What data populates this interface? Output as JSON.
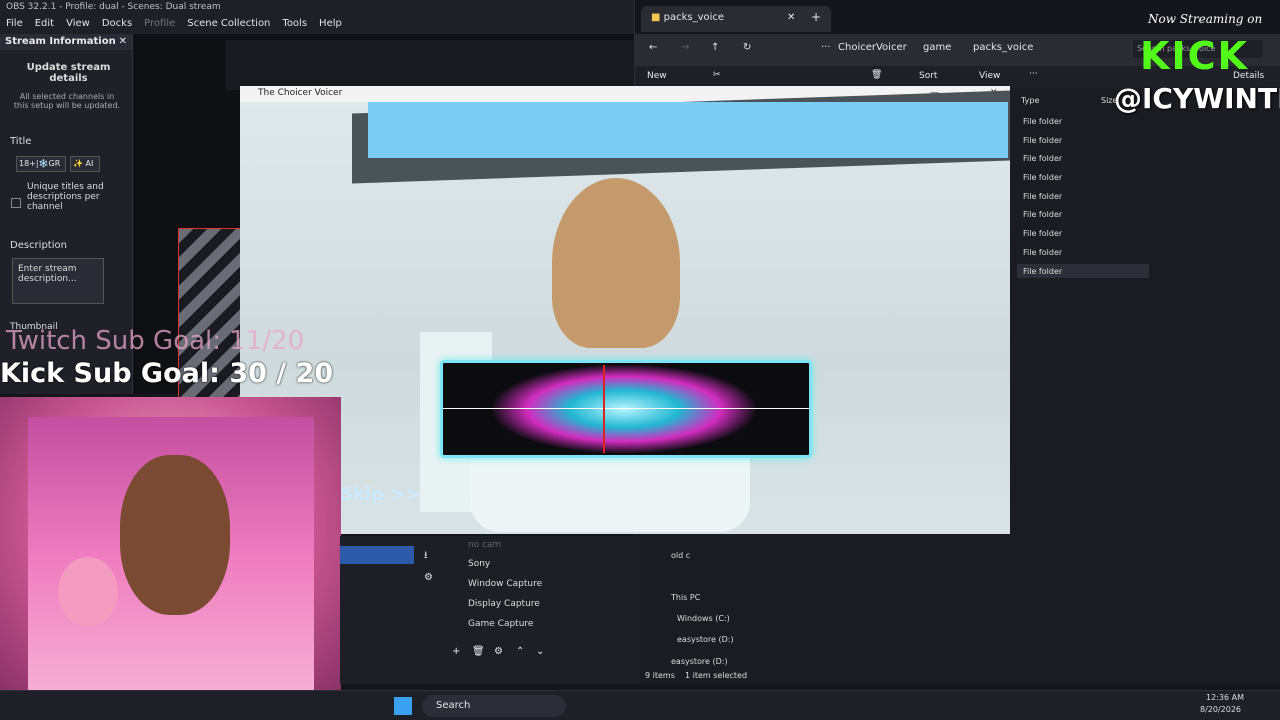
{
  "obs": {
    "title": "OBS 32.2.1 - Profile: dual - Scenes: Dual stream",
    "menu": [
      "File",
      "Edit",
      "View",
      "Docks",
      "Profile",
      "Scene Collection",
      "Tools",
      "Help"
    ],
    "stream_info": {
      "header": "Stream Information",
      "heading": "Update stream details",
      "note": "All selected channels in this setup will be updated.",
      "title_label": "Title",
      "title_value": "18+|❄️GR",
      "ai_button": "✨ AI",
      "unique_label": "Unique titles and descriptions per channel",
      "description_label": "Description",
      "description_placeholder": "Enter stream description...",
      "thumbnail_label": "Thumbnail"
    },
    "sources": [
      "no cam",
      "Sony",
      "Window Capture",
      "Display Capture",
      "Game Capture"
    ]
  },
  "overlay": {
    "twitch_goal": "Twitch Sub Goal: 11/20",
    "kick_goal": "Kick Sub Goal: 30 / 20",
    "skip": "Skip >>",
    "kick_streaming": "Now Streaming on",
    "kick_logo": "KICK",
    "kick_handle": "@ICYWINTRR"
  },
  "explorer": {
    "tab_title": "packs_voice",
    "breadcrumb": [
      "ChoicerVoicer",
      "game",
      "packs_voice"
    ],
    "search_placeholder": "Search packs_voice",
    "toolbar": {
      "new": "New",
      "sort": "Sort",
      "view": "View",
      "details": "Details"
    },
    "columns": {
      "type": "Type",
      "size": "Size"
    },
    "rows": [
      "File folder",
      "File folder",
      "File folder",
      "File folder",
      "File folder",
      "File folder",
      "File folder",
      "File folder",
      "File folder"
    ],
    "nav": {
      "old_c": "old c",
      "this_pc": "This PC",
      "windows_c": "Windows (C:)",
      "easystore_d1": "easystore (D:)",
      "easystore_d2": "easystore (D:)"
    },
    "status": {
      "items": "9 items",
      "selected": "1 item selected"
    }
  },
  "game": {
    "title": "The Choicer Voicer"
  },
  "taskbar": {
    "search": "Search",
    "time": "12:36 AM",
    "date": "8/20/2026"
  },
  "colors": {
    "kick_green": "#53fc18",
    "wave_cyan": "#7fe3f6",
    "wave_magenta": "#ff3ad6"
  }
}
